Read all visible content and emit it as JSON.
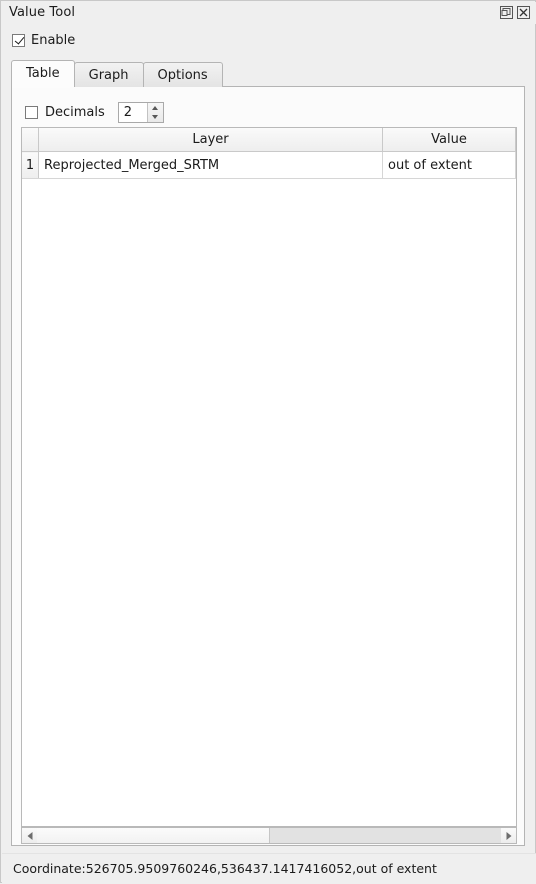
{
  "window": {
    "title": "Value Tool",
    "buttons": [
      {
        "name": "float-icon",
        "tooltip": "Undock"
      },
      {
        "name": "close-icon",
        "tooltip": "Close"
      }
    ]
  },
  "enable": {
    "label": "Enable",
    "checked": true
  },
  "tabs": [
    {
      "label": "Table",
      "selected": true
    },
    {
      "label": "Graph",
      "selected": false
    },
    {
      "label": "Options",
      "selected": false
    }
  ],
  "decimals": {
    "label": "Decimals",
    "checked": false,
    "value": "2"
  },
  "table": {
    "columns": [
      "Layer",
      "Value"
    ],
    "rows": [
      {
        "index": "1",
        "layer": "Reprojected_Merged_SRTM",
        "value": "out of extent"
      }
    ]
  },
  "scrollbar": {
    "left_arrow": "◀",
    "right_arrow": "▶"
  },
  "status": {
    "text": "Coordinate:526705.9509760246,536437.1417416052,out of extent"
  },
  "colors": {
    "window_bg": "#efefef",
    "panel_bg": "#fbfbfb",
    "table_bg": "#ffffff",
    "border": "#b4b4b4",
    "text": "#1b1b1b"
  }
}
